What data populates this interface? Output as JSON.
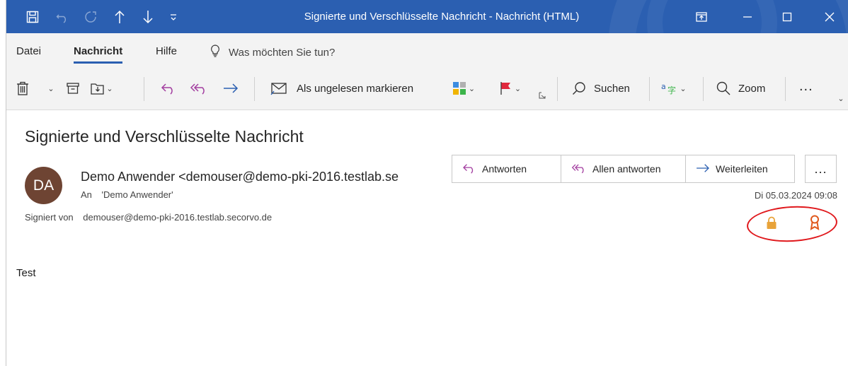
{
  "window": {
    "title": "Signierte und Verschlüsselte Nachricht  -  Nachricht (HTML)",
    "accent": "#2b5fb1"
  },
  "tabs": [
    "Datei",
    "Nachricht",
    "Hilfe"
  ],
  "active_tab": "Nachricht",
  "tell_me": "Was möchten Sie tun?",
  "toolbar": {
    "mark_unread": "Als ungelesen markieren",
    "search": "Suchen",
    "zoom": "Zoom",
    "more": "..."
  },
  "message": {
    "subject": "Signierte und Verschlüsselte Nachricht",
    "avatar_initials": "DA",
    "avatar_color": "#6e4433",
    "sender": "Demo Anwender <demouser@demo-pki-2016.testlab.se",
    "to_label": "An",
    "to": "'Demo Anwender'",
    "signed_label": "Signiert von",
    "signed_by": "demouser@demo-pki-2016.testlab.secorvo.de",
    "date": "Di 05.03.2024 09:08",
    "body": "Test"
  },
  "actions": {
    "reply": "Antworten",
    "reply_all": "Allen antworten",
    "forward": "Weiterleiten",
    "more": "..."
  },
  "security_icons": [
    "lock-icon",
    "certificate-ribbon-icon"
  ],
  "highlight_color": "#e0181c"
}
